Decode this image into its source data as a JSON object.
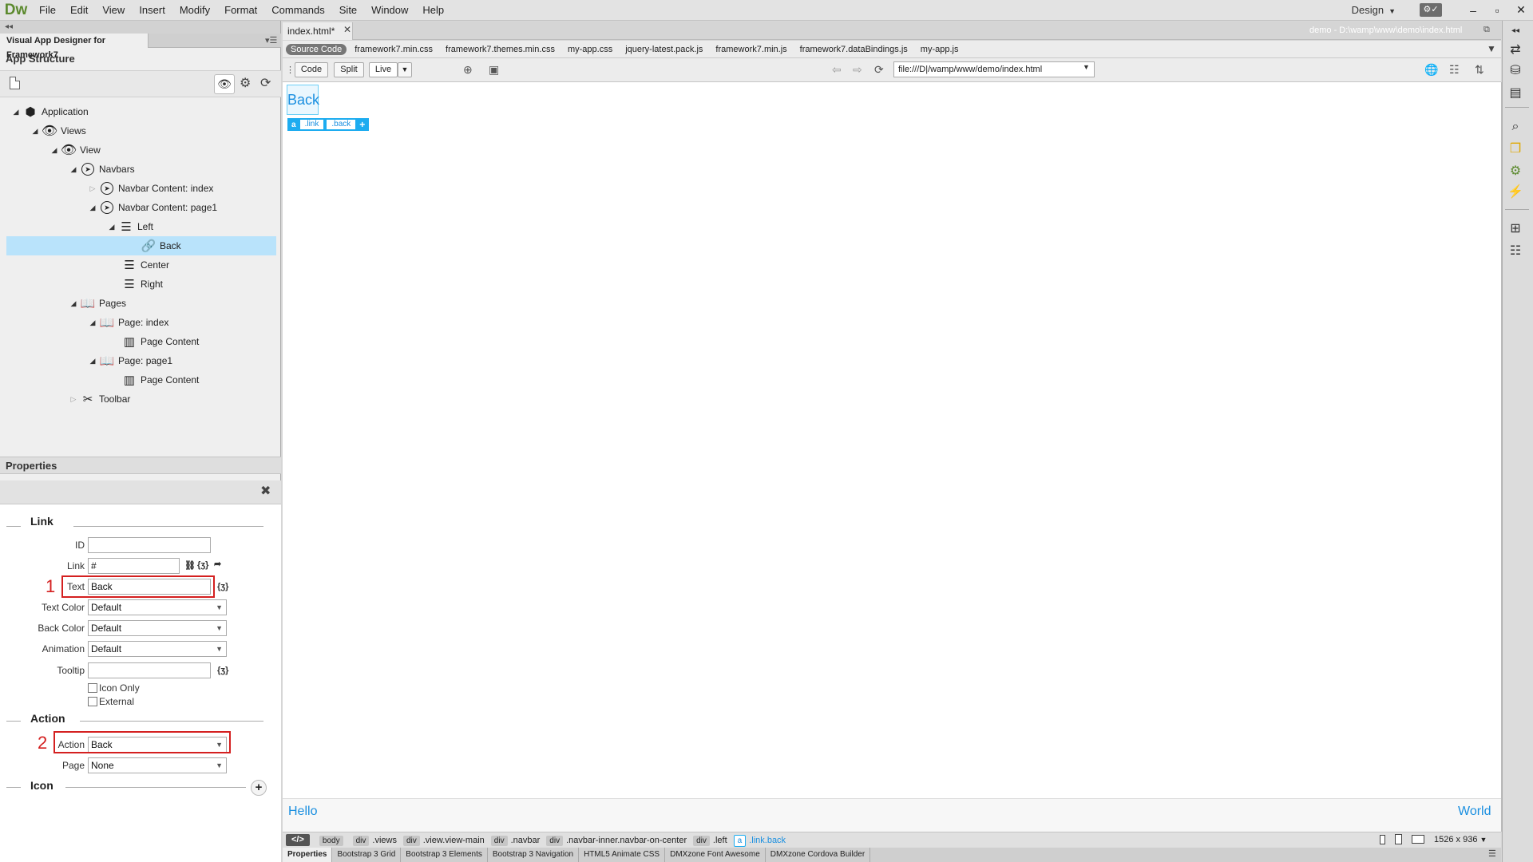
{
  "app": {
    "logo": "Dw",
    "menu": [
      "File",
      "Edit",
      "View",
      "Insert",
      "Modify",
      "Format",
      "Commands",
      "Site",
      "Window",
      "Help"
    ],
    "workspace": "Design",
    "window_buttons": [
      "–",
      "▫",
      "✕"
    ]
  },
  "left_panel": {
    "tab_title": "Visual App Designer for Framework7",
    "app_structure_title": "App Structure",
    "tree": [
      {
        "label": "Application",
        "icon": "cube-icon",
        "expanded": true
      },
      {
        "label": "Views",
        "icon": "eye-icon",
        "expanded": true
      },
      {
        "label": "View",
        "icon": "eye-icon",
        "expanded": true
      },
      {
        "label": "Navbars",
        "icon": "compass-icon",
        "expanded": true
      },
      {
        "label": "Navbar Content: index",
        "icon": "compass-icon",
        "expanded": false
      },
      {
        "label": "Navbar Content: page1",
        "icon": "compass-icon",
        "expanded": true
      },
      {
        "label": "Left",
        "icon": "align-left-icon",
        "expanded": true
      },
      {
        "label": "Back",
        "icon": "link-icon",
        "selected": true
      },
      {
        "label": "Center",
        "icon": "align-center-icon"
      },
      {
        "label": "Right",
        "icon": "align-right-icon"
      },
      {
        "label": "Pages",
        "icon": "book-icon",
        "expanded": true
      },
      {
        "label": "Page: index",
        "icon": "page-icon",
        "expanded": true
      },
      {
        "label": "Page Content",
        "icon": "page-content-icon"
      },
      {
        "label": "Page: page1",
        "icon": "page-icon",
        "expanded": true
      },
      {
        "label": "Page Content",
        "icon": "page-content-icon"
      },
      {
        "label": "Toolbar",
        "icon": "tools-icon",
        "expanded": false
      }
    ]
  },
  "properties": {
    "title": "Properties",
    "link_section": "Link",
    "id_label": "ID",
    "id_value": "",
    "link_label": "Link",
    "link_value": "#",
    "text_label": "Text",
    "text_value": "Back",
    "text_color_label": "Text Color",
    "text_color_value": "Default",
    "back_color_label": "Back Color",
    "back_color_value": "Default",
    "animation_label": "Animation",
    "animation_value": "Default",
    "tooltip_label": "Tooltip",
    "tooltip_value": "",
    "icon_only_label": "Icon Only",
    "external_label": "External",
    "action_section": "Action",
    "action_label": "Action",
    "action_value": "Back",
    "page_label": "Page",
    "page_value": "None",
    "icon_section": "Icon",
    "bind_symbol": "{ʒ}",
    "annotation_1": "1",
    "annotation_2": "2"
  },
  "document": {
    "tab_title": "index.html*",
    "path": "demo - D:\\wamp\\www\\demo\\index.html",
    "related_files": [
      "Source Code",
      "framework7.min.css",
      "framework7.themes.min.css",
      "my-app.css",
      "jquery-latest.pack.js",
      "framework7.min.js",
      "framework7.dataBindings.js",
      "my-app.js"
    ],
    "view_buttons": {
      "code": "Code",
      "split": "Split",
      "live": "Live"
    },
    "address": "file:///D|/wamp/www/demo/index.html",
    "back_link_text": "Back",
    "hud": {
      "tag": "a",
      "classes": [
        ".link",
        ".back"
      ],
      "add": "+"
    },
    "hello": "Hello",
    "world": "World",
    "breadcrumbs": [
      {
        "tag": "",
        "label": "body"
      },
      {
        "tag": "div",
        "label": ".views"
      },
      {
        "tag": "div",
        "label": ".view.view-main"
      },
      {
        "tag": "div",
        "label": ".navbar"
      },
      {
        "tag": "div",
        "label": ".navbar-inner.navbar-on-center"
      },
      {
        "tag": "div",
        "label": ".left"
      },
      {
        "tag": "a",
        "label": ".link.back"
      }
    ],
    "code_nav": "</>",
    "viewport_size": "1526 x 936",
    "bottom_tabs": [
      "Properties",
      "Bootstrap 3 Grid",
      "Bootstrap 3 Elements",
      "Bootstrap 3 Navigation",
      "HTML5 Animate CSS",
      "DMXzone Font Awesome",
      "DMXzone Cordova Builder"
    ]
  },
  "colors": {
    "accent": "#1dacf0",
    "link_blue": "#1a8fe0",
    "selection": "#b9e3fb",
    "annotation_red": "#d42020",
    "logo_green": "#5c8a2e"
  }
}
